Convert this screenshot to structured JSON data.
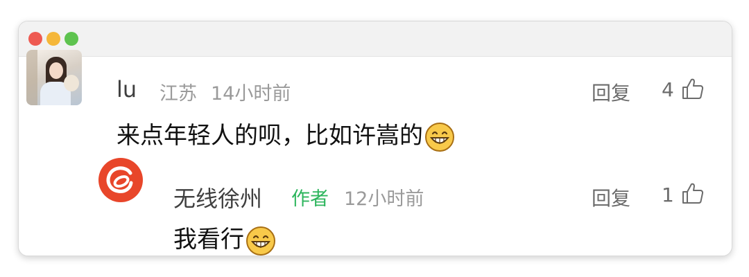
{
  "comments": [
    {
      "user": "lu",
      "location": "江苏",
      "time": "14小时前",
      "text": "来点年轻人的呗，比如许嵩的",
      "reply_label": "回复",
      "likes": "4"
    }
  ],
  "reply": {
    "user": "无线徐州",
    "badge": "作者",
    "time": "12小时前",
    "text": "我看行",
    "reply_label": "回复",
    "likes": "1"
  },
  "icons": {
    "like": "thumbs-up-icon",
    "emoji": "grinning-face-icon"
  },
  "colors": {
    "author_badge": "#2db55d",
    "brand_avatar": "#e8462a"
  }
}
